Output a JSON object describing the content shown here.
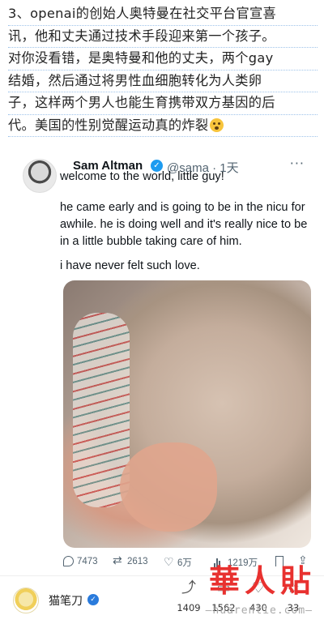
{
  "article": {
    "lines": [
      "3、openai的创始人奥特曼在社交平台官宣喜",
      "讯，他和丈夫通过技术手段迎来第一个孩子。",
      "对你没看错，是奥特曼和他的丈夫，两个gay",
      "结婚，然后通过将男性血细胞转化为人类卵",
      "子，这样两个男人也能生育携带双方基因的后",
      "代。美国的性别觉醒运动真的炸裂"
    ],
    "emoji": "flushed-face-emoji"
  },
  "tweet": {
    "author_name": "Sam Altman",
    "handle_time": "@sama · 1天",
    "more": "···",
    "line1": "welcome to the world, little guy!",
    "para2": "he came early and is going to be in the nicu for awhile. he is doing well and it's really nice to be in a little bubble taking care of him.",
    "para3": "i have never felt such love.",
    "photo": "newborn-baby-photo",
    "stats": {
      "replies": "7473",
      "retweets": "2613",
      "likes": "6万",
      "views": "1219万"
    }
  },
  "footer": {
    "user_name": "猫笔刀",
    "stats": {
      "share": "1409",
      "comments": "1562",
      "likes": "430",
      "favorites": "33"
    }
  },
  "watermark": {
    "main": "華人貼",
    "url": "—huarentie.com—"
  },
  "colors": {
    "twitter_blue": "#1d9bf0",
    "watermark_red": "#e8312f",
    "link_underline": "#9ec3ea"
  }
}
